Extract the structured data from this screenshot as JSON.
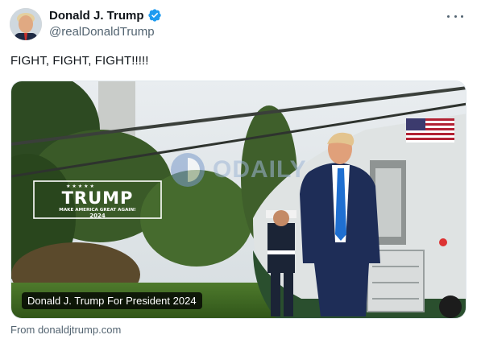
{
  "author": {
    "display_name": "Donald J. Trump",
    "handle": "@realDonaldTrump",
    "verified": true
  },
  "tweet": {
    "text": "FIGHT, FIGHT, FIGHT!!!!!"
  },
  "card": {
    "sign_title": "TRUMP",
    "sign_subtitle": "MAKE AMERICA GREAT AGAIN!",
    "sign_year": "2024",
    "watermark": "ODAILY",
    "caption": "Donald J. Trump For President 2024",
    "domain": "From donaldjtrump.com"
  },
  "icons": {
    "more": "more-horizontal-icon",
    "verified": "verified-badge-icon"
  },
  "colors": {
    "verified": "#1d9bf0",
    "text_primary": "#0f1419",
    "text_secondary": "#536471"
  }
}
